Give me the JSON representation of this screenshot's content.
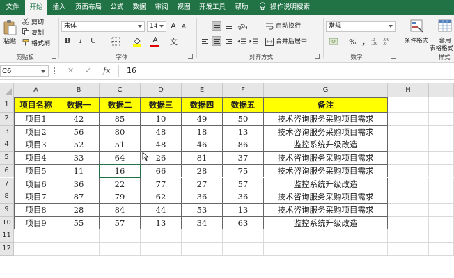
{
  "tabs": [
    {
      "label": "文件",
      "active": false
    },
    {
      "label": "开始",
      "active": true
    },
    {
      "label": "插入",
      "active": false
    },
    {
      "label": "页面布局",
      "active": false
    },
    {
      "label": "公式",
      "active": false
    },
    {
      "label": "数据",
      "active": false
    },
    {
      "label": "审阅",
      "active": false
    },
    {
      "label": "视图",
      "active": false
    },
    {
      "label": "开发工具",
      "active": false
    },
    {
      "label": "帮助",
      "active": false
    }
  ],
  "tell_me": "操作说明搜索",
  "ribbon": {
    "clipboard": {
      "paste": "粘贴",
      "cut": "剪切",
      "copy": "复制",
      "format_painter": "格式刷",
      "group": "剪贴板"
    },
    "font": {
      "name": "宋体",
      "size": "14",
      "bold": "B",
      "italic": "I",
      "underline": "U",
      "grow": "A",
      "shrink": "A",
      "color_letter": "A",
      "group": "字体"
    },
    "alignment": {
      "wrap": "自动换行",
      "merge": "合并后居中",
      "group": "对齐方式"
    },
    "number": {
      "format": "常规",
      "group": "数字"
    },
    "styles": {
      "conditional": "条件格式",
      "table_style_line1": "套用",
      "table_style_line2": "表格格式",
      "group": "样式"
    },
    "colors": {
      "accent": "#217346",
      "fill": "#ffff00",
      "font_color": "#e00000"
    }
  },
  "formula_bar": {
    "name_box": "C6",
    "cancel": "✕",
    "enter": "✓",
    "fx": "fx",
    "value": "16"
  },
  "sheet": {
    "columns": [
      "A",
      "B",
      "C",
      "D",
      "E",
      "F",
      "G",
      "H",
      "I"
    ],
    "rows": [
      "1",
      "2",
      "3",
      "4",
      "5",
      "6",
      "7",
      "8",
      "9",
      "10",
      "11",
      "12"
    ],
    "header": [
      "项目名称",
      "数据一",
      "数据二",
      "数据三",
      "数据四",
      "数据五",
      "备注"
    ],
    "data": [
      [
        "项目1",
        "42",
        "85",
        "10",
        "49",
        "50",
        "技术咨询服务采购项目需求"
      ],
      [
        "项目2",
        "56",
        "80",
        "48",
        "18",
        "13",
        "技术咨询服务采购项目需求"
      ],
      [
        "项目3",
        "52",
        "51",
        "48",
        "46",
        "86",
        "监控系统升级改造"
      ],
      [
        "项目4",
        "33",
        "64",
        "26",
        "81",
        "37",
        "技术咨询服务采购项目需求"
      ],
      [
        "项目5",
        "11",
        "16",
        "66",
        "28",
        "75",
        "技术咨询服务采购项目需求"
      ],
      [
        "项目6",
        "36",
        "22",
        "77",
        "27",
        "57",
        "监控系统升级改造"
      ],
      [
        "项目7",
        "87",
        "79",
        "62",
        "36",
        "36",
        "技术咨询服务采购项目需求"
      ],
      [
        "项目8",
        "28",
        "84",
        "44",
        "53",
        "13",
        "技术咨询服务采购项目需求"
      ],
      [
        "项目9",
        "55",
        "57",
        "13",
        "34",
        "63",
        "监控系统升级改造"
      ]
    ],
    "header_fill": "#ffff00",
    "selected_cell": "C6"
  }
}
